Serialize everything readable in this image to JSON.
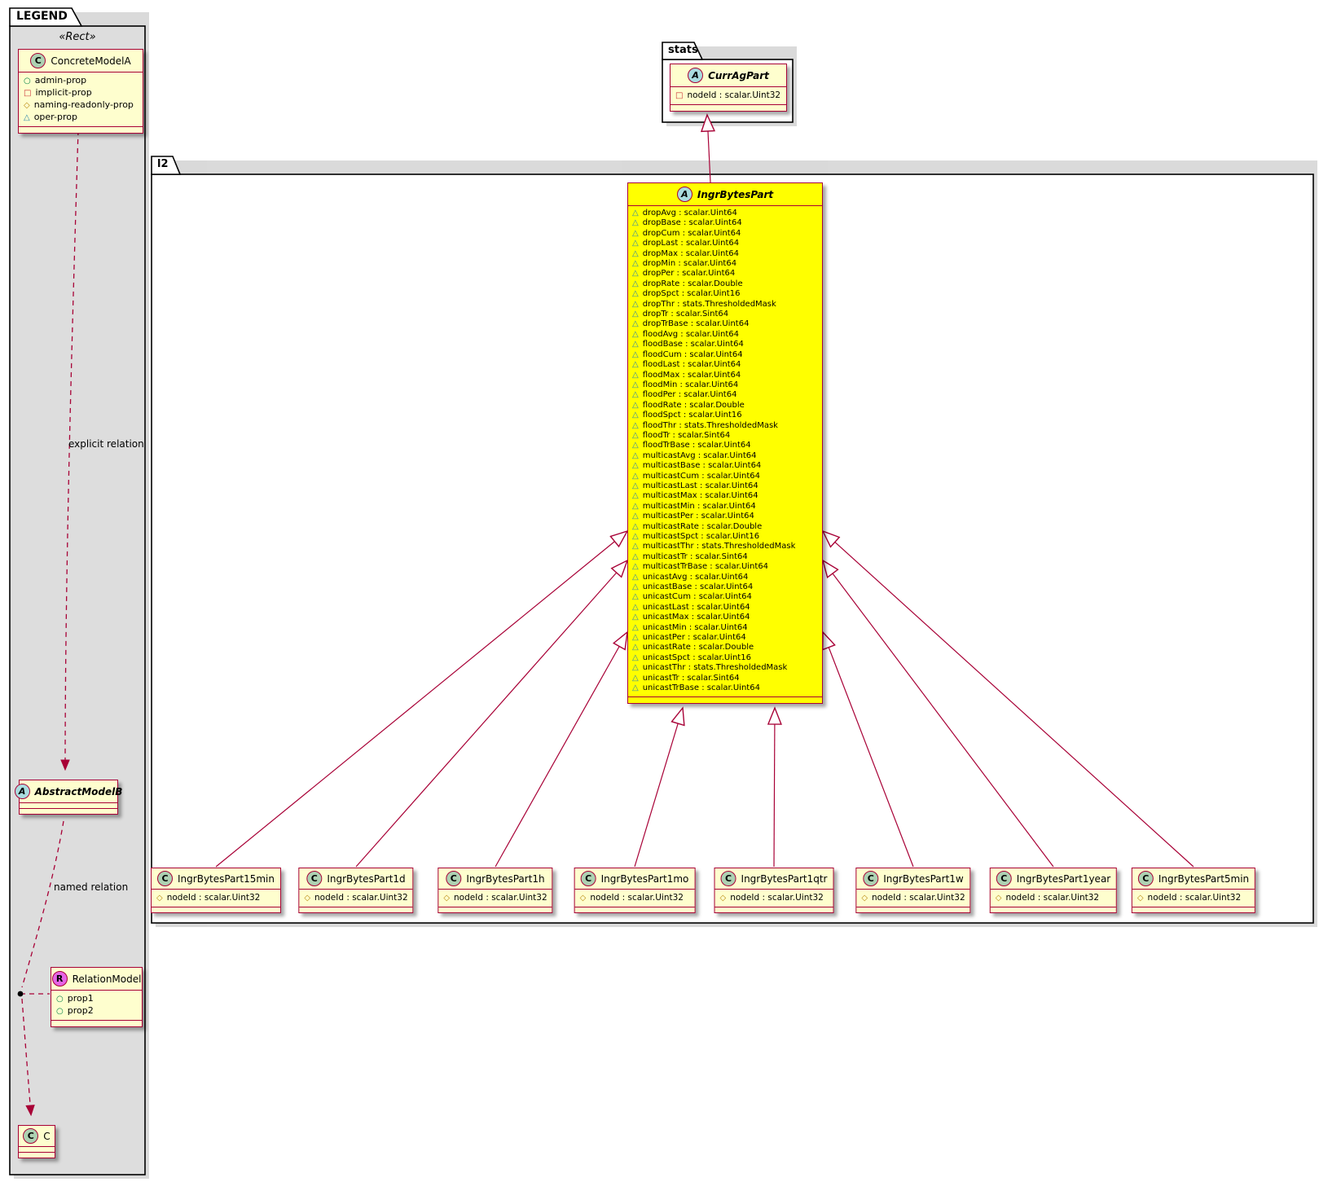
{
  "legend": {
    "tab": "LEGEND",
    "stereotype": "«Rect»",
    "explicit_relation_label": "explicit relation",
    "named_relation_label": "named relation",
    "concrete_model": {
      "spot": "C",
      "name": "ConcreteModelA",
      "attrs": [
        {
          "vis": "public",
          "label": "admin-prop"
        },
        {
          "vis": "private",
          "label": "implicit-prop"
        },
        {
          "vis": "protected",
          "label": "naming-readonly-prop"
        },
        {
          "vis": "package",
          "label": "oper-prop"
        }
      ]
    },
    "abstract_model": {
      "spot": "A",
      "name": "AbstractModelB"
    },
    "relation_model": {
      "spot": "R",
      "name": "RelationModel",
      "attrs": [
        {
          "vis": "public",
          "label": "prop1"
        },
        {
          "vis": "public",
          "label": "prop2"
        }
      ]
    },
    "c_model": {
      "spot": "C",
      "name": "C"
    }
  },
  "stats_package": {
    "tab": "stats",
    "curr_ag_part": {
      "spot": "A",
      "name": "CurrAgPart",
      "attrs": [
        {
          "vis": "private",
          "label": "nodeId : scalar.Uint32"
        }
      ]
    }
  },
  "l2_package": {
    "tab": "l2",
    "ingr_bytes_part": {
      "spot": "A",
      "name": "IngrBytesPart",
      "attrs": [
        {
          "vis": "package",
          "label": "dropAvg : scalar.Uint64"
        },
        {
          "vis": "package",
          "label": "dropBase : scalar.Uint64"
        },
        {
          "vis": "package",
          "label": "dropCum : scalar.Uint64"
        },
        {
          "vis": "package",
          "label": "dropLast : scalar.Uint64"
        },
        {
          "vis": "package",
          "label": "dropMax : scalar.Uint64"
        },
        {
          "vis": "package",
          "label": "dropMin : scalar.Uint64"
        },
        {
          "vis": "package",
          "label": "dropPer : scalar.Uint64"
        },
        {
          "vis": "package",
          "label": "dropRate : scalar.Double"
        },
        {
          "vis": "package",
          "label": "dropSpct : scalar.Uint16"
        },
        {
          "vis": "package",
          "label": "dropThr : stats.ThresholdedMask"
        },
        {
          "vis": "package",
          "label": "dropTr : scalar.Sint64"
        },
        {
          "vis": "package",
          "label": "dropTrBase : scalar.Uint64"
        },
        {
          "vis": "package",
          "label": "floodAvg : scalar.Uint64"
        },
        {
          "vis": "package",
          "label": "floodBase : scalar.Uint64"
        },
        {
          "vis": "package",
          "label": "floodCum : scalar.Uint64"
        },
        {
          "vis": "package",
          "label": "floodLast : scalar.Uint64"
        },
        {
          "vis": "package",
          "label": "floodMax : scalar.Uint64"
        },
        {
          "vis": "package",
          "label": "floodMin : scalar.Uint64"
        },
        {
          "vis": "package",
          "label": "floodPer : scalar.Uint64"
        },
        {
          "vis": "package",
          "label": "floodRate : scalar.Double"
        },
        {
          "vis": "package",
          "label": "floodSpct : scalar.Uint16"
        },
        {
          "vis": "package",
          "label": "floodThr : stats.ThresholdedMask"
        },
        {
          "vis": "package",
          "label": "floodTr : scalar.Sint64"
        },
        {
          "vis": "package",
          "label": "floodTrBase : scalar.Uint64"
        },
        {
          "vis": "package",
          "label": "multicastAvg : scalar.Uint64"
        },
        {
          "vis": "package",
          "label": "multicastBase : scalar.Uint64"
        },
        {
          "vis": "package",
          "label": "multicastCum : scalar.Uint64"
        },
        {
          "vis": "package",
          "label": "multicastLast : scalar.Uint64"
        },
        {
          "vis": "package",
          "label": "multicastMax : scalar.Uint64"
        },
        {
          "vis": "package",
          "label": "multicastMin : scalar.Uint64"
        },
        {
          "vis": "package",
          "label": "multicastPer : scalar.Uint64"
        },
        {
          "vis": "package",
          "label": "multicastRate : scalar.Double"
        },
        {
          "vis": "package",
          "label": "multicastSpct : scalar.Uint16"
        },
        {
          "vis": "package",
          "label": "multicastThr : stats.ThresholdedMask"
        },
        {
          "vis": "package",
          "label": "multicastTr : scalar.Sint64"
        },
        {
          "vis": "package",
          "label": "multicastTrBase : scalar.Uint64"
        },
        {
          "vis": "package",
          "label": "unicastAvg : scalar.Uint64"
        },
        {
          "vis": "package",
          "label": "unicastBase : scalar.Uint64"
        },
        {
          "vis": "package",
          "label": "unicastCum : scalar.Uint64"
        },
        {
          "vis": "package",
          "label": "unicastLast : scalar.Uint64"
        },
        {
          "vis": "package",
          "label": "unicastMax : scalar.Uint64"
        },
        {
          "vis": "package",
          "label": "unicastMin : scalar.Uint64"
        },
        {
          "vis": "package",
          "label": "unicastPer : scalar.Uint64"
        },
        {
          "vis": "package",
          "label": "unicastRate : scalar.Double"
        },
        {
          "vis": "package",
          "label": "unicastSpct : scalar.Uint16"
        },
        {
          "vis": "package",
          "label": "unicastThr : stats.ThresholdedMask"
        },
        {
          "vis": "package",
          "label": "unicastTr : scalar.Sint64"
        },
        {
          "vis": "package",
          "label": "unicastTrBase : scalar.Uint64"
        }
      ]
    },
    "children": [
      {
        "spot": "C",
        "name": "IngrBytesPart15min",
        "attrs": [
          {
            "vis": "protected",
            "label": "nodeId : scalar.Uint32"
          }
        ]
      },
      {
        "spot": "C",
        "name": "IngrBytesPart1d",
        "attrs": [
          {
            "vis": "protected",
            "label": "nodeId : scalar.Uint32"
          }
        ]
      },
      {
        "spot": "C",
        "name": "IngrBytesPart1h",
        "attrs": [
          {
            "vis": "protected",
            "label": "nodeId : scalar.Uint32"
          }
        ]
      },
      {
        "spot": "C",
        "name": "IngrBytesPart1mo",
        "attrs": [
          {
            "vis": "protected",
            "label": "nodeId : scalar.Uint32"
          }
        ]
      },
      {
        "spot": "C",
        "name": "IngrBytesPart1qtr",
        "attrs": [
          {
            "vis": "protected",
            "label": "nodeId : scalar.Uint32"
          }
        ]
      },
      {
        "spot": "C",
        "name": "IngrBytesPart1w",
        "attrs": [
          {
            "vis": "protected",
            "label": "nodeId : scalar.Uint32"
          }
        ]
      },
      {
        "spot": "C",
        "name": "IngrBytesPart1year",
        "attrs": [
          {
            "vis": "protected",
            "label": "nodeId : scalar.Uint32"
          }
        ]
      },
      {
        "spot": "C",
        "name": "IngrBytesPart5min",
        "attrs": [
          {
            "vis": "protected",
            "label": "nodeId : scalar.Uint32"
          }
        ]
      }
    ]
  },
  "colors": {
    "class_bg": "#FEFECE",
    "highlight_bg": "#FFFF00",
    "border_red": "#A80036",
    "legend_bg": "#DDDDDD",
    "spot_class_green": "#ADD1B2",
    "spot_abstract_blue": "#A9DCDF",
    "spot_relation_magenta": "#E564E5",
    "vis_public_green": "#038048",
    "vis_private_red": "#C82930",
    "vis_protected_gold": "#B8860B",
    "vis_package_blue": "#2E86AB"
  }
}
